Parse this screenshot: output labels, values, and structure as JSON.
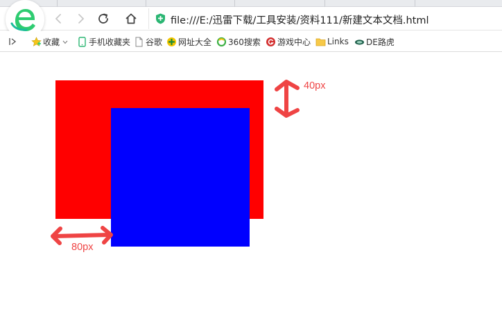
{
  "browser": {
    "address_bar": {
      "url": "file:///E:/迅雷下载/工具安装/资料111/新建文本文档.html"
    },
    "icons": {
      "logo": "browser-logo-icon",
      "back": "back-arrow-icon",
      "forward": "forward-arrow-icon",
      "reload": "reload-icon",
      "home": "home-icon",
      "security": "shield-icon"
    }
  },
  "bookmarks": {
    "items": [
      {
        "label": "收藏",
        "icon": "star-icon"
      },
      {
        "label": "手机收藏夹",
        "icon": "phone-icon"
      },
      {
        "label": "谷歌",
        "icon": "page-icon"
      },
      {
        "label": "网址大全",
        "icon": "site-icon"
      },
      {
        "label": "360搜索",
        "icon": "search-360-icon"
      },
      {
        "label": "游戏中心",
        "icon": "game-icon"
      },
      {
        "label": "Links",
        "icon": "folder-icon"
      },
      {
        "label": "DE路虎",
        "icon": "car-icon"
      }
    ]
  },
  "page": {
    "colors": {
      "red_box": "#ff0000",
      "blue_box": "#0000ff",
      "annotation": "#ef4444"
    },
    "annotations": {
      "vertical": "40px",
      "horizontal": "80px"
    }
  }
}
